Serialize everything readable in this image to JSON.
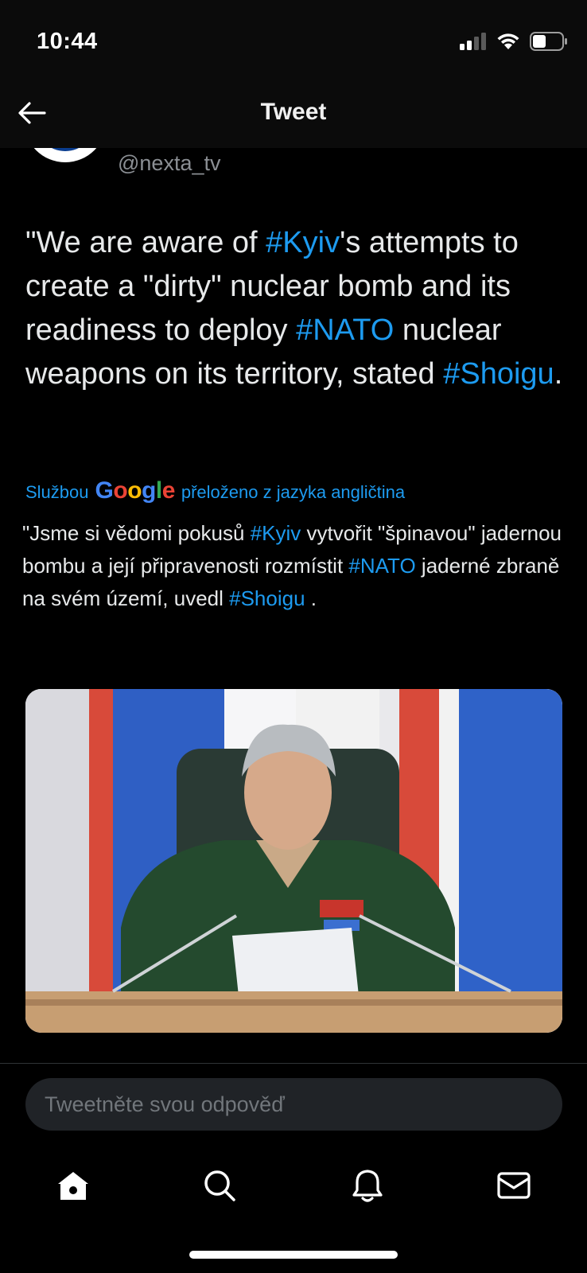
{
  "status_bar": {
    "time": "10:44"
  },
  "header": {
    "title": "Tweet"
  },
  "author": {
    "handle": "@nexta_tv",
    "avatar_letter": "N"
  },
  "tweet": {
    "segments": [
      {
        "text": "\"We are aware of ",
        "hashtag": false
      },
      {
        "text": "#Kyiv",
        "hashtag": true
      },
      {
        "text": "'s attempts to create a \"dirty\" nuclear bomb and its readiness to deploy ",
        "hashtag": false
      },
      {
        "text": "#NATO",
        "hashtag": true
      },
      {
        "text": " nuclear weapons on its territory, stated ",
        "hashtag": false
      },
      {
        "text": "#Shoigu",
        "hashtag": true
      },
      {
        "text": ".",
        "hashtag": false
      }
    ]
  },
  "translation": {
    "prefix": "Službou",
    "provider": "Google",
    "suffix": "přeloženo z jazyka angličtina",
    "segments": [
      {
        "text": "\"Jsme si vědomi pokusů ",
        "hashtag": false
      },
      {
        "text": "#Kyiv",
        "hashtag": true
      },
      {
        "text": " vytvořit \"špinavou\" jadernou bombu a její připravenosti rozmístit ",
        "hashtag": false
      },
      {
        "text": "#NATO",
        "hashtag": true
      },
      {
        "text": " jaderné zbraně na svém území, uvedl ",
        "hashtag": false
      },
      {
        "text": "#Shoigu",
        "hashtag": true
      },
      {
        "text": " .",
        "hashtag": false
      }
    ]
  },
  "reply": {
    "placeholder": "Tweetněte svou odpověď"
  },
  "tab_bar": {
    "icons": [
      "home-icon",
      "search-icon",
      "bell-icon",
      "mail-icon"
    ]
  },
  "colors": {
    "background": "#000000",
    "text": "#e7e9ea",
    "accent": "#1d9bf0",
    "muted": "#8b8f94"
  }
}
